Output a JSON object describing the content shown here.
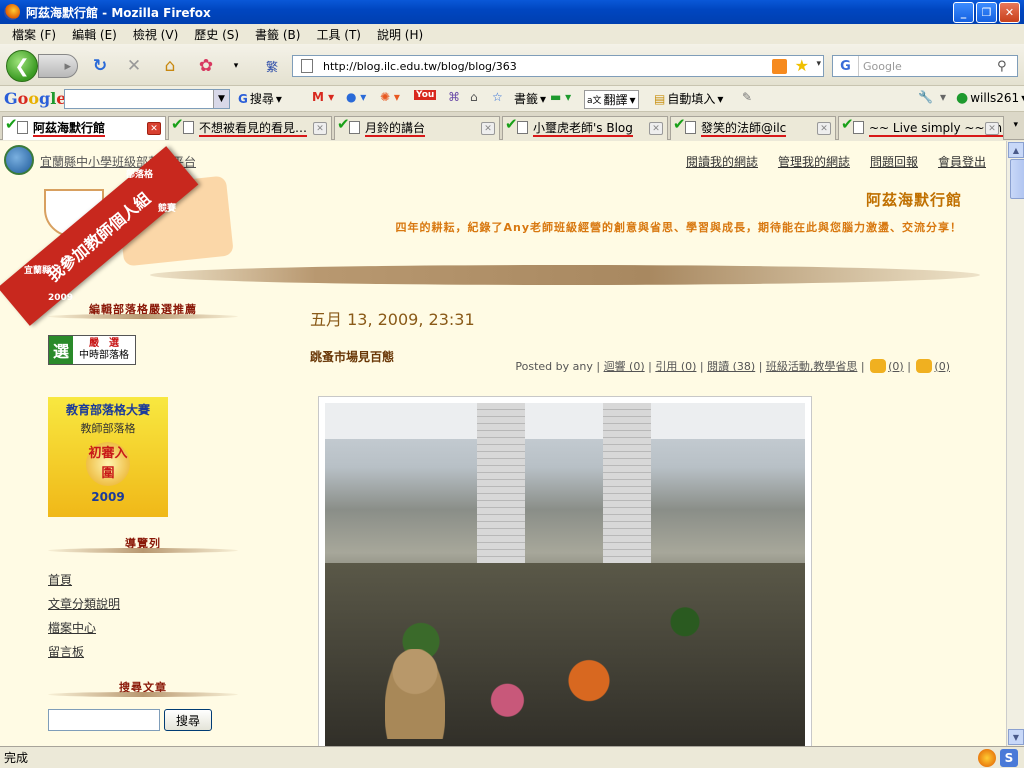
{
  "window": {
    "title": "阿茲海默行館 - Mozilla Firefox"
  },
  "menu": [
    "檔案 (F)",
    "編輯 (E)",
    "檢視 (V)",
    "歷史 (S)",
    "書籤 (B)",
    "工具 (T)",
    "說明 (H)"
  ],
  "nav": {
    "url": "http://blog.ilc.edu.tw/blog/blog/363",
    "search_placeholder": "Google",
    "trad_label": "繁"
  },
  "gbar": {
    "search_label": "搜尋",
    "bookmarks_label": "書籤",
    "translate_label": "翻譯",
    "autofill_label": "自動填入",
    "user": "wills261"
  },
  "tabs": [
    {
      "title": "阿茲海默行館"
    },
    {
      "title": "不想被看見的看見…"
    },
    {
      "title": "月鈴的講台"
    },
    {
      "title": "小璽虎老師's Blog"
    },
    {
      "title": "發笑的法師@ilc"
    },
    {
      "title": "~~ Live simply ~~Lin…"
    }
  ],
  "site": {
    "platform": "宜蘭縣中小學班級部落格平台",
    "links": [
      "閱讀我的網誌",
      "管理我的網誌",
      "問題回報",
      "會員登出"
    ],
    "blog_title": "阿茲海默行館",
    "blog_desc": "四年的耕耘，紀錄了Any老師班級經營的創意與省思、學習與成長，期待能在此與您腦力激盪、交流分享！",
    "ribbon_main": "我參加教師個人組",
    "ribbon_year": "2009",
    "ribbon_county": "宜蘭縣",
    "ribbon_blog": "部落格",
    "ribbon_contest": "競賽"
  },
  "sidebar": {
    "hdr_recommend": "編輯部落格嚴選推薦",
    "badge1_mark": "選",
    "badge1_top": "嚴　選",
    "badge1_bottom": "中時部落格",
    "badge2_l1": "教育部落格大賽",
    "badge2_l2": "教師部落格",
    "badge2_medal": "初審入圍",
    "badge2_year": "2009",
    "hdr_nav": "導覽列",
    "nav_items": [
      "首頁",
      "文章分類說明",
      "檔案中心",
      "留言板"
    ],
    "hdr_search": "搜尋文章",
    "search_btn": "搜尋"
  },
  "post": {
    "date": "五月 13, 2009, 23:31",
    "title": "跳蚤市場見百態",
    "posted_by": "Posted by any |",
    "reply": "迴響 (0)",
    "cite": "引用 (0)",
    "reads": "閱讀 (38)",
    "cats": "班級活動,教學省思",
    "up": "(0)",
    "down": "(0)"
  },
  "status": {
    "text": "完成"
  }
}
